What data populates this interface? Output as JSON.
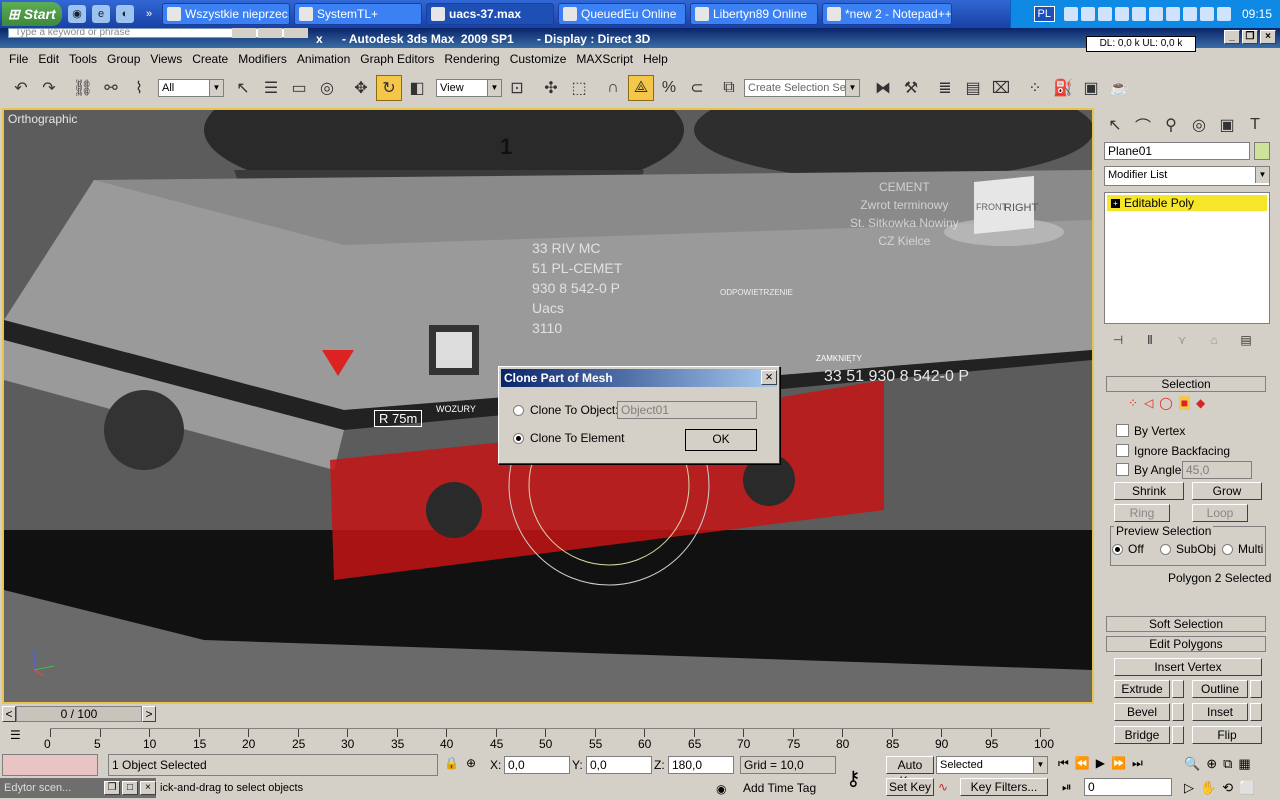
{
  "taskbar": {
    "start_label": "Start",
    "buttons": [
      {
        "label": "Wszystkie nieprzec..."
      },
      {
        "label": "SystemTL+"
      },
      {
        "label": "uacs-37.max"
      },
      {
        "label": "QueuedEu Online"
      },
      {
        "label": "Libertyn89 Online"
      },
      {
        "label": "*new 2 - Notepad++"
      }
    ],
    "language": "PL",
    "clock": "09:15"
  },
  "titlebar": {
    "search_placeholder": "Type a keyword or phrase",
    "title": "- Autodesk 3ds Max  2009 SP1       - Display : Direct 3D",
    "title_prefix": "x",
    "netmeter": "DL: 0,0 k  UL: 0,0 k"
  },
  "menu": [
    "File",
    "Edit",
    "Tools",
    "Group",
    "Views",
    "Create",
    "Modifiers",
    "Animation",
    "Graph Editors",
    "Rendering",
    "Customize",
    "MAXScript",
    "Help"
  ],
  "toolbar": {
    "selection_filter": "All",
    "ref_coord": "View",
    "named_selection_placeholder": "Create Selection Set"
  },
  "viewport": {
    "label": "Orthographic",
    "viewcube_front": "FRONT",
    "viewcube_right": "RIGHT",
    "texts": {
      "number_1": "1",
      "rivmc": "33 RIV MC\n51 PL-CEMET\n930 8 542-0 P\nUacs\n3110",
      "cement": "CEMENT\nZwrot terminowy\nSt. Sitkowka Nowiny\nCZ Kielce",
      "car_number": "33 51 930 8 542-0 P",
      "r75m": "R 75m",
      "wozury": "WOZURY",
      "zamknij": "ZAMKNIĘTY",
      "odpowietrzenie": "ODPOWIETRZENIE"
    }
  },
  "dialog": {
    "title": "Clone Part of Mesh",
    "close": "×",
    "opt_object": "Clone To Object:",
    "object_name": "Object01",
    "opt_element": "Clone To Element",
    "ok": "OK"
  },
  "command_panel": {
    "object_name": "Plane01",
    "modifier_list": "Modifier List",
    "stack_item": "Editable Poly",
    "selection_title": "Selection",
    "by_vertex": "By Vertex",
    "ignore_backfacing": "Ignore Backfacing",
    "by_angle": "By Angle:",
    "by_angle_value": "45,0",
    "shrink": "Shrink",
    "grow": "Grow",
    "ring": "Ring",
    "loop": "Loop",
    "preview_selection": "Preview Selection",
    "preview_off": "Off",
    "preview_subobj": "SubObj",
    "preview_multi": "Multi",
    "selection_status": "Polygon 2 Selected",
    "soft_selection": "Soft Selection",
    "edit_polygons": "Edit Polygons",
    "insert_vertex": "Insert Vertex",
    "extrude": "Extrude",
    "outline": "Outline",
    "bevel": "Bevel",
    "inset": "Inset",
    "bridge": "Bridge",
    "flip": "Flip"
  },
  "timeline": {
    "frame_counter": "0 / 100",
    "ticks": [
      "0",
      "5",
      "10",
      "15",
      "20",
      "25",
      "30",
      "35",
      "40",
      "45",
      "50",
      "55",
      "60",
      "65",
      "70",
      "75",
      "80",
      "85",
      "90",
      "95",
      "100"
    ]
  },
  "status": {
    "selected": "1 Object Selected",
    "prompt": "ick-and-drag to select objects",
    "x_label": "X:",
    "x_value": "0,0",
    "y_label": "Y:",
    "y_value": "0,0",
    "z_label": "Z:",
    "z_value": "180,0",
    "grid": "Grid = 10,0",
    "add_time_tag": "Add Time Tag",
    "auto_key": "Auto Key",
    "set_key": "Set Key",
    "key_mode": "Selected",
    "key_filters": "Key Filters...",
    "frame": "0",
    "scene_explorer": "Edytor scen..."
  },
  "colors": {
    "accent_yellow": "#f4c64a",
    "selection_red": "#c41414",
    "title_blue": "#0a246a"
  }
}
